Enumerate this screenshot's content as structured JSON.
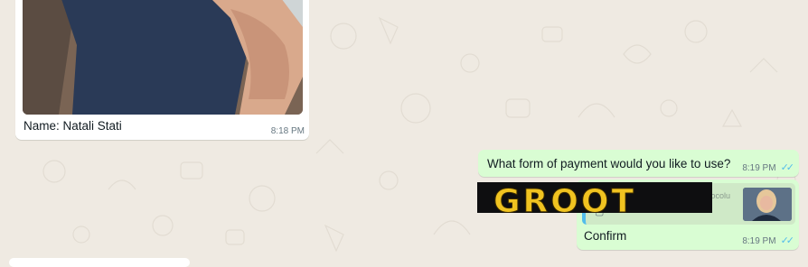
{
  "chat": {
    "incoming": {
      "caption": "Name: Natali Stati",
      "time": "8:18 PM"
    },
    "outgoing": [
      {
        "text": "What form of payment would you like to use?",
        "time": "8:19 PM",
        "status_icon": "double-check-icon"
      },
      {
        "quoted_banner": "GROOT",
        "quoted_sender": "Ciocolu",
        "text": "Confirm",
        "time": "8:19 PM",
        "status_icon": "double-check-icon"
      }
    ]
  },
  "colors": {
    "background": "#efeae2",
    "outgoing_bubble": "#d9fdd3",
    "incoming_bubble": "#ffffff",
    "read_check": "#53bdeb"
  }
}
